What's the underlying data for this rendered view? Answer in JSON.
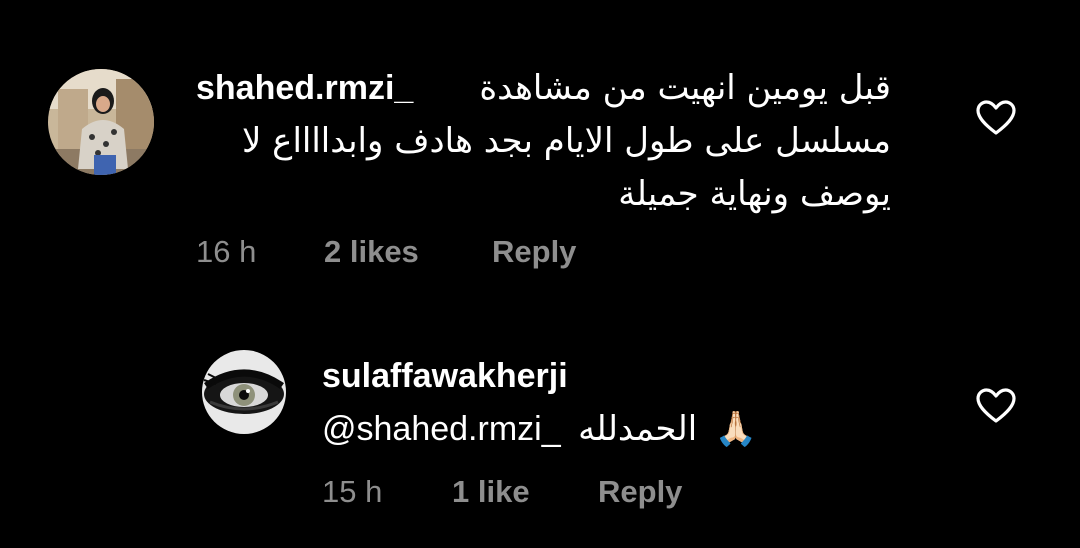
{
  "comments": [
    {
      "username": "shahed.rmzi_",
      "text_lines": [
        "قبل يومين انهيت من مشاهدة",
        "مسلسل على طول الايام بجد هادف وابدااااع لا",
        "يوصف ونهاية جميلة"
      ],
      "time": "16 h",
      "likes": "2 likes",
      "reply_label": "Reply",
      "avatar_icon": "user-photo-avatar",
      "heart_icon": "heart-outline-icon"
    },
    {
      "username": "sulaffawakherji",
      "mention": "@shahed.rmzi_",
      "text": "الحمدلله",
      "emoji": "🙏🏻",
      "time": "15 h",
      "likes": "1 like",
      "reply_label": "Reply",
      "avatar_icon": "eye-avatar",
      "heart_icon": "heart-outline-icon"
    }
  ],
  "colors": {
    "background": "#000000",
    "text": "#ffffff",
    "meta": "#8e8e8e"
  }
}
